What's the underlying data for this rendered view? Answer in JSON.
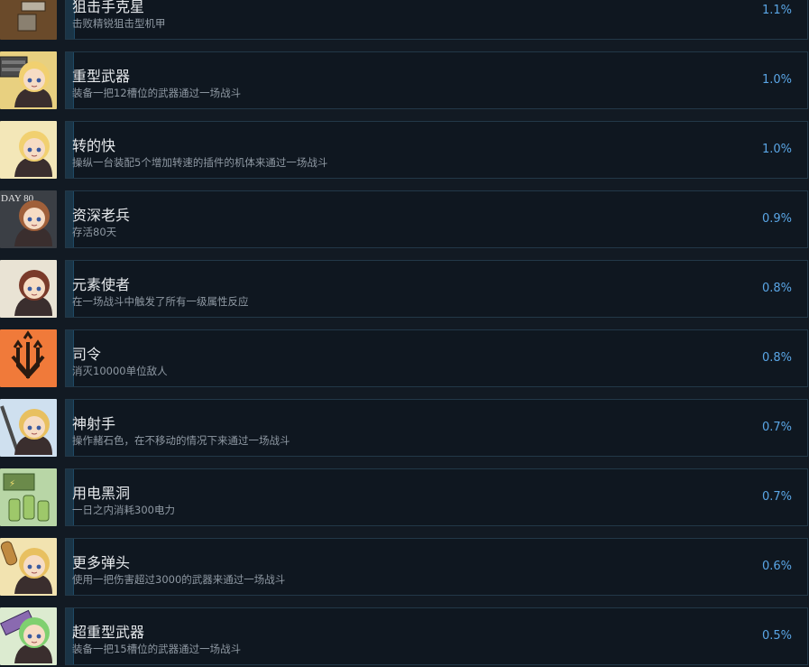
{
  "achievements": [
    {
      "title": "狙击手克星",
      "desc": "击败精锐狙击型机甲",
      "pct": "1.1%",
      "fill": 0.011,
      "icon": "sniper-mech-icon",
      "bg": "#6a4a2a"
    },
    {
      "title": "重型武器",
      "desc": "装备一把12槽位的武器通过一场战斗",
      "pct": "1.0%",
      "fill": 0.01,
      "icon": "heavy-weapon-icon",
      "bg": "#e8d080"
    },
    {
      "title": "转的快",
      "desc": "操纵一台装配5个增加转速的插件的机体来通过一场战斗",
      "pct": "1.0%",
      "fill": 0.01,
      "icon": "spinning-girl-icon",
      "bg": "#f3e7b8"
    },
    {
      "title": "资深老兵",
      "desc": "存活80天",
      "pct": "0.9%",
      "fill": 0.009,
      "icon": "veteran-girl-icon",
      "bg": "#3b3f45",
      "label": "DAY 80"
    },
    {
      "title": "元素使者",
      "desc": "在一场战斗中触发了所有一级属性反应",
      "pct": "0.8%",
      "fill": 0.008,
      "icon": "element-mage-icon",
      "bg": "#e9e3d4"
    },
    {
      "title": "司令",
      "desc": "消灭10000单位敌人",
      "pct": "0.8%",
      "fill": 0.008,
      "icon": "commander-trident-icon",
      "bg": "#f07a3a"
    },
    {
      "title": "神射手",
      "desc": "操作赭石色，在不移动的情况下来通过一场战斗",
      "pct": "0.7%",
      "fill": 0.007,
      "icon": "marksman-icon",
      "bg": "#cfe0ef"
    },
    {
      "title": "用电黑洞",
      "desc": "一日之内消耗300电力",
      "pct": "0.7%",
      "fill": 0.007,
      "icon": "battery-icon",
      "bg": "#b8d6a6"
    },
    {
      "title": "更多弹头",
      "desc": "使用一把伤害超过3000的武器来通过一场战斗",
      "pct": "0.6%",
      "fill": 0.006,
      "icon": "bullet-girl-icon",
      "bg": "#f2e3b0"
    },
    {
      "title": "超重型武器",
      "desc": "装备一把15槽位的武器通过一场战斗",
      "pct": "0.5%",
      "fill": 0.005,
      "icon": "super-heavy-weapon-icon",
      "bg": "#dcebd0"
    }
  ]
}
